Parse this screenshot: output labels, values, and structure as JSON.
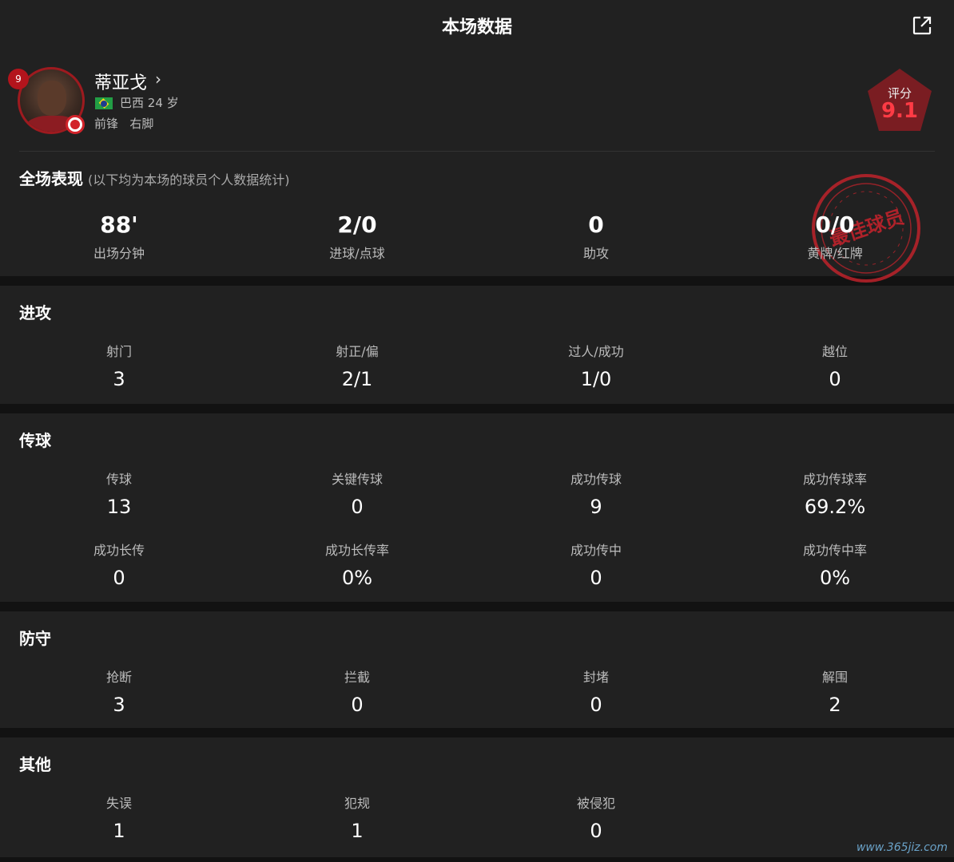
{
  "header": {
    "title": "本场数据",
    "share_icon": "external-link-icon"
  },
  "player": {
    "name": "蒂亚戈",
    "chevron": "›",
    "jersey_number": "9",
    "nationality": "巴西",
    "age": "24 岁",
    "position": "前锋",
    "foot": "右脚",
    "rating_label": "评分",
    "rating_value": "9.1",
    "best_player_stamp": "最佳球员"
  },
  "overview": {
    "title": "全场表现",
    "subtitle": "(以下均为本场的球员个人数据统计)",
    "stats": [
      {
        "value": "88'",
        "label": "出场分钟"
      },
      {
        "value": "2/0",
        "label": "进球/点球"
      },
      {
        "value": "0",
        "label": "助攻"
      },
      {
        "value": "0/0",
        "label": "黄牌/红牌"
      }
    ]
  },
  "sections": {
    "attack": {
      "title": "进攻",
      "stats": [
        {
          "label": "射门",
          "value": "3"
        },
        {
          "label": "射正/偏",
          "value": "2/1"
        },
        {
          "label": "过人/成功",
          "value": "1/0"
        },
        {
          "label": "越位",
          "value": "0"
        }
      ]
    },
    "passing": {
      "title": "传球",
      "stats": [
        {
          "label": "传球",
          "value": "13"
        },
        {
          "label": "关键传球",
          "value": "0"
        },
        {
          "label": "成功传球",
          "value": "9"
        },
        {
          "label": "成功传球率",
          "value": "69.2%"
        },
        {
          "label": "成功长传",
          "value": "0"
        },
        {
          "label": "成功长传率",
          "value": "0%"
        },
        {
          "label": "成功传中",
          "value": "0"
        },
        {
          "label": "成功传中率",
          "value": "0%"
        }
      ]
    },
    "defense": {
      "title": "防守",
      "stats": [
        {
          "label": "抢断",
          "value": "3"
        },
        {
          "label": "拦截",
          "value": "0"
        },
        {
          "label": "封堵",
          "value": "0"
        },
        {
          "label": "解围",
          "value": "2"
        }
      ]
    },
    "other": {
      "title": "其他",
      "stats": [
        {
          "label": "失误",
          "value": "1"
        },
        {
          "label": "犯规",
          "value": "1"
        },
        {
          "label": "被侵犯",
          "value": "0"
        }
      ]
    }
  },
  "watermark": "www.365jiz.com",
  "colors": {
    "accent": "#ff3b45",
    "badge": "#b3141c",
    "panel": "#212121",
    "background": "#121212"
  }
}
